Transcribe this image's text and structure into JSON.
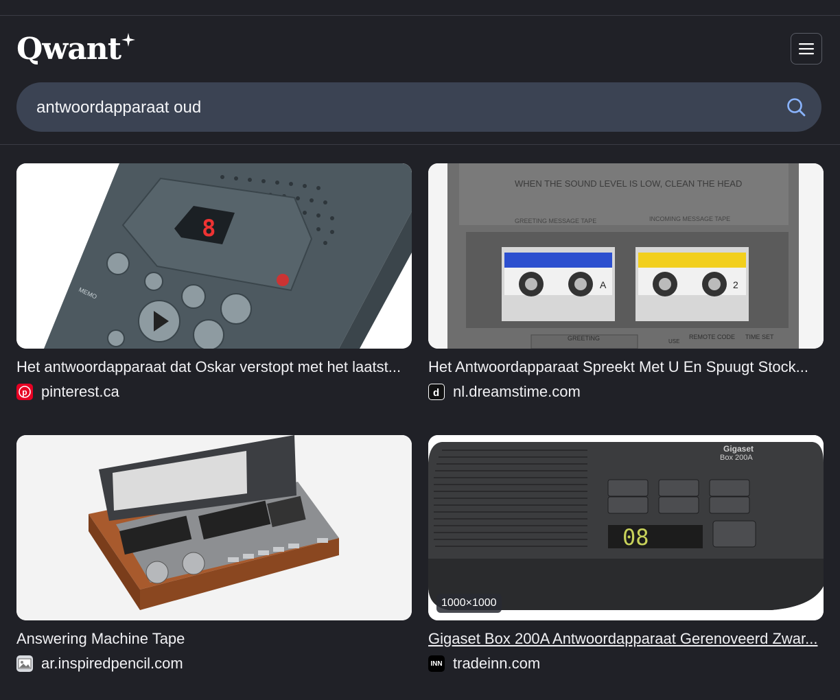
{
  "brand": {
    "logo_text": "Qwant"
  },
  "search": {
    "query": "antwoordapparaat oud"
  },
  "results": [
    {
      "title": "Het antwoordapparaat dat Oskar verstopt met het laatst...",
      "domain": "pinterest.ca",
      "favicon": "pinterest-icon"
    },
    {
      "title": "Het Antwoordapparaat Spreekt Met U En Spuugt Stock...",
      "domain": "nl.dreamstime.com",
      "favicon": "dreamstime-icon",
      "image_text": {
        "top": "WHEN THE SOUND LEVEL IS LOW, CLEAN THE HEAD",
        "left_tape": "GREETING MESSAGE TAPE",
        "right_tape": "INCOMING MESSAGE TAPE",
        "bottom_left": "GREETING",
        "bottom_mid": "REMOTE CODE",
        "bottom_right": "TIME SET",
        "use": "USE",
        "tape_a": "A",
        "tape_2": "2"
      }
    },
    {
      "title": "Answering Machine Tape",
      "domain": "ar.inspiredpencil.com",
      "favicon": "inspiredpencil-icon"
    },
    {
      "title": "Gigaset Box 200A Antwoordapparaat Gerenoveerd Zwar...",
      "domain": "tradeinn.com",
      "favicon": "tradeinn-icon",
      "dimensions": "1000×1000",
      "image_text": {
        "brand": "Gigaset",
        "model": "Box 200A",
        "display": "08"
      },
      "favicon_text": "INN"
    }
  ],
  "colors": {
    "background": "#202127",
    "search_bar": "#3b4353",
    "search_icon": "#8ab4ff"
  }
}
